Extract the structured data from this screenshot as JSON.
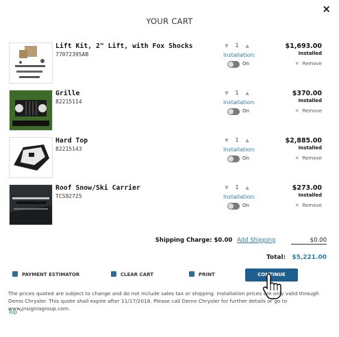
{
  "title": "YOUR CART",
  "close_icon": "×",
  "items": [
    {
      "name": "Lift Kit, 2\" Lift, with Fox Shocks",
      "part": "77072395AB",
      "qty": "1",
      "installation_label": "Installation:",
      "toggle_label": "On",
      "price": "$1,693.00",
      "installed": "Installed",
      "remove": "Remove",
      "icon": "lift-kit-icon"
    },
    {
      "name": "Grille",
      "part": "82215114",
      "qty": "1",
      "installation_label": "Installation:",
      "toggle_label": "On",
      "price": "$370.00",
      "installed": "Installed",
      "remove": "Remove",
      "icon": "grille-icon"
    },
    {
      "name": "Hard Top",
      "part": "82215143",
      "qty": "1",
      "installation_label": "Installation:",
      "toggle_label": "On",
      "price": "$2,885.00",
      "installed": "Installed",
      "remove": "Remove",
      "icon": "hard-top-icon"
    },
    {
      "name": "Roof Snow/Ski Carrier",
      "part": "TCS92725",
      "qty": "1",
      "installation_label": "Installation:",
      "toggle_label": "On",
      "price": "$273.00",
      "installed": "Installed",
      "remove": "Remove",
      "icon": "ski-carrier-icon"
    }
  ],
  "shipping": {
    "label": "Shipping Charge: $0.00",
    "link": "Add Shipping",
    "value": "$0.00"
  },
  "total": {
    "label": "Total:",
    "amount": "$5,221.00"
  },
  "actions": {
    "payment": "PAYMENT ESTIMATOR",
    "clear": "CLEAR CART",
    "print": "PRINT",
    "continue": "CONTINUE"
  },
  "disclaimer": "The prices quoted are subject to change and do not include sales tax or shipping. Installation prices are only valid through Demo Chrysler. This quote shall expire after 11/17/2018. Please call Demo Chrysler for further details or go to www.insigniagroup.com.",
  "top_link": "Top ^",
  "colors": {
    "accent": "#2c7aa3",
    "button": "#1f5f8f",
    "row_shade": "#f3f3f3"
  }
}
